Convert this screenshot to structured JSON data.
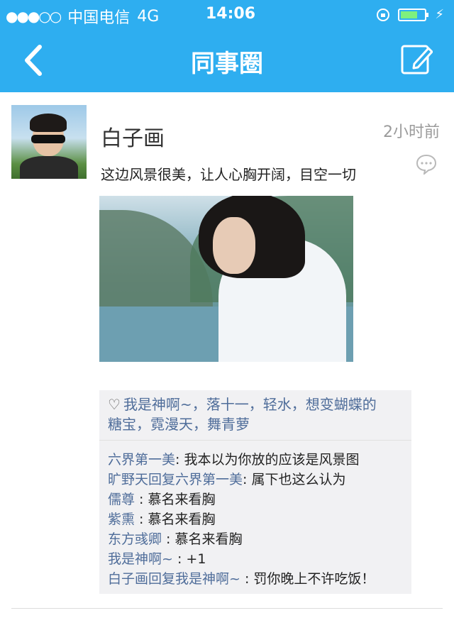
{
  "statusbar": {
    "signal_dots": "●●●○○",
    "carrier": "中国电信",
    "network": "4G",
    "time": "14:06",
    "battery_level": 0.7
  },
  "navbar": {
    "title": "同事圈"
  },
  "post": {
    "username": "白子画",
    "time": "2小时前",
    "text": "这边风景很美，让人心胸开阔，目空一切",
    "likes": [
      "我是神啊~",
      "落十一",
      "轻水",
      "想变蝴蝶的糖宝",
      "霓漫天",
      "舞青萝"
    ],
    "likes_line1": "我是神啊~，落十一，轻水，想变蝴蝶的",
    "likes_line2": "糖宝，霓漫天，舞青萝",
    "comments": [
      {
        "name": "六界第一美",
        "sep": ": ",
        "text": "我本以为你放的应该是风景图"
      },
      {
        "name": "旷野天回复六界第一美",
        "sep": ": ",
        "text": "属下也这么认为"
      },
      {
        "name": "儒尊",
        "sep": " : ",
        "text": "慕名来看胸"
      },
      {
        "name": "紫熏",
        "sep": " : ",
        "text": "慕名来看胸"
      },
      {
        "name": "东方彧卿",
        "sep": " : ",
        "text": "慕名来看胸"
      },
      {
        "name": "我是神啊~",
        "sep": " : ",
        "text": "+1"
      },
      {
        "name": "白子画回复我是神啊~",
        "sep": " : ",
        "text": "罚你晚上不许吃饭！"
      }
    ]
  },
  "colors": {
    "accent": "#2eaef0",
    "name_link": "#4f6d9a"
  },
  "icons": {
    "back": "chevron-left-icon",
    "edit": "edit-icon",
    "comment": "comment-icon",
    "like": "heart-icon"
  }
}
